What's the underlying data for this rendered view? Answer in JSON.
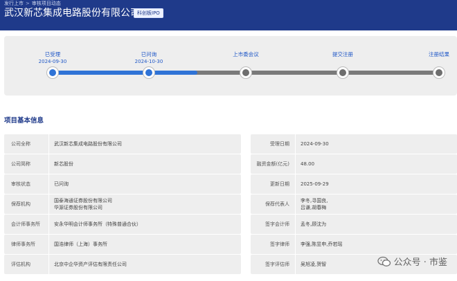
{
  "breadcrumb": {
    "items": [
      "发行上市",
      "审核项目动态"
    ],
    "separator": ">"
  },
  "company": {
    "title": "武汉新芯集成电路股份有限公司",
    "badge": "科创板IPO"
  },
  "progress": {
    "steps": [
      {
        "label": "已受理",
        "date": "2024-09-30",
        "status": "done"
      },
      {
        "label": "已问询",
        "date": "2024-10-30",
        "status": "done"
      },
      {
        "label": "上市委会议",
        "date": "",
        "status": "pending"
      },
      {
        "label": "提交注册",
        "date": "",
        "status": "pending"
      },
      {
        "label": "注册结果",
        "date": "",
        "status": "pending"
      }
    ],
    "completed_fraction": 0.375,
    "active_color": "#2f73d6",
    "pending_color": "#6e6e6e"
  },
  "section": {
    "title": "项目基本信息"
  },
  "info": {
    "left": [
      {
        "label": "公司全称",
        "value": [
          "武汉新芯集成电路股份有限公司"
        ]
      },
      {
        "label": "公司简称",
        "value": [
          "新芯股份"
        ]
      },
      {
        "label": "审核状态",
        "value": [
          "已问询"
        ]
      },
      {
        "label": "保荐机构",
        "value": [
          "国泰海通证券股份有限公司",
          "华源证券股份有限公司"
        ]
      },
      {
        "label": "会计师事务所",
        "value": [
          "安永华明会计师事务所（特殊普通合伙）"
        ]
      },
      {
        "label": "律师事务所",
        "value": [
          "国浩律师（上海）事务所"
        ]
      },
      {
        "label": "评估机构",
        "value": [
          "北京中企华资产评估有限责任公司"
        ]
      }
    ],
    "right": [
      {
        "label": "受理日期",
        "value": [
          "2024-09-30"
        ]
      },
      {
        "label": "融资金额(亿元)",
        "value": [
          "48.00"
        ]
      },
      {
        "label": "更新日期",
        "value": [
          "2025-09-29"
        ]
      },
      {
        "label": "保荐代表人",
        "value": [
          "李冬,寻国良,",
          "吕谦,胡春梅"
        ]
      },
      {
        "label": "签字会计师",
        "value": [
          "孟冬,顾沈为"
        ]
      },
      {
        "label": "签字律师",
        "value": [
          "李强,陈昱申,乔若瑶"
        ]
      },
      {
        "label": "签字评估师",
        "value": [
          "吴旭凌,贺智"
        ]
      }
    ]
  },
  "watermark": {
    "text": "公众号 · 市鉴",
    "icon": "wechat-icon"
  },
  "colors": {
    "header": "#1f3a8a",
    "accent": "#2f73d6",
    "panel": "#eeeeee"
  }
}
